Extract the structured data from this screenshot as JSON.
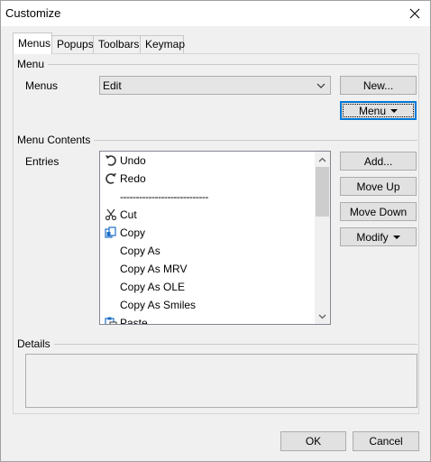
{
  "window": {
    "title": "Customize"
  },
  "tabs": [
    {
      "label": "Menus",
      "active": true
    },
    {
      "label": "Popups",
      "active": false
    },
    {
      "label": "Toolbars",
      "active": false
    },
    {
      "label": "Keymap",
      "active": false
    }
  ],
  "menu_group": {
    "label": "Menu",
    "menus_label": "Menus",
    "menus_selected": "Edit",
    "new_button": "New...",
    "menu_button": "Menu"
  },
  "contents_group": {
    "label": "Menu Contents",
    "entries_label": "Entries",
    "entries": [
      {
        "label": "Undo",
        "icon": "undo-icon"
      },
      {
        "label": "Redo",
        "icon": "redo-icon"
      },
      {
        "label": "----------------------------",
        "icon": ""
      },
      {
        "label": "Cut",
        "icon": "scissors-icon"
      },
      {
        "label": "Copy",
        "icon": "copy-icon"
      },
      {
        "label": "Copy As",
        "icon": ""
      },
      {
        "label": "Copy As MRV",
        "icon": ""
      },
      {
        "label": "Copy As OLE",
        "icon": ""
      },
      {
        "label": "Copy As Smiles",
        "icon": ""
      },
      {
        "label": "Paste",
        "icon": "paste-icon"
      }
    ],
    "add_button": "Add...",
    "move_up_button": "Move Up",
    "move_down_button": "Move Down",
    "modify_button": "Modify"
  },
  "details_group": {
    "label": "Details"
  },
  "footer": {
    "ok_button": "OK",
    "cancel_button": "Cancel"
  },
  "colors": {
    "accent": "#0078d7",
    "icon_blue": "#1e6fc8"
  }
}
